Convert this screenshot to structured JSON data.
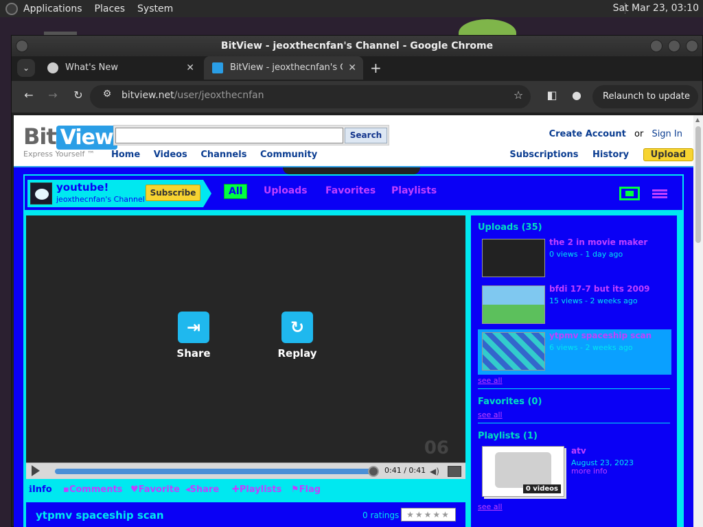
{
  "panel": {
    "applications": "Applications",
    "places": "Places",
    "system": "System",
    "clock": "Sat Mar 23, 03:10"
  },
  "window": {
    "title": "BitView - jeoxthecnfan's Channel - Google Chrome"
  },
  "tabs": [
    {
      "label": "What's New",
      "close": "✕"
    },
    {
      "label": "BitView - jeoxthecnfan's Cha",
      "close": "✕"
    }
  ],
  "toolbar": {
    "url_host": "bitview.net",
    "url_path": "/user/jeoxthecnfan",
    "relaunch": "Relaunch to update"
  },
  "site": {
    "logo_bit": "Bit",
    "logo_view": "View",
    "tagline": "Express Yourself ™",
    "search_button": "Search",
    "search_value": "",
    "nav": [
      "Home",
      "Videos",
      "Channels",
      "Community"
    ],
    "create_account": "Create Account",
    "or": "or",
    "sign_in": "Sign In",
    "subnav": [
      "Subscriptions",
      "History"
    ],
    "upload": "Upload"
  },
  "channel": {
    "name": "youtube!",
    "subtitle": "jeoxthecnfan's Channel",
    "subscribe": "Subscribe",
    "tabs": [
      "All",
      "Uploads",
      "Favorites",
      "Playlists"
    ]
  },
  "player": {
    "share": "Share",
    "replay": "Replay",
    "watermark": "06",
    "time": "0:41 / 0:41",
    "progress_fraction": 1.0
  },
  "info_tabs": [
    "Info",
    "Comments",
    "Favorite",
    "Share",
    "Playlists",
    "Flag"
  ],
  "video": {
    "title": "ytpmv spaceship scan",
    "ratings": "0 ratings"
  },
  "sidebar": {
    "uploads_heading": "Uploads (35)",
    "uploads": [
      {
        "title": "the 2 in movie maker",
        "meta": "0 views - 1 day ago"
      },
      {
        "title": "bfdi 17-7 but its 2009",
        "meta": "15 views - 2 weeks ago"
      },
      {
        "title": "ytpmv spaceship scan",
        "meta": "6 views - 2 weeks ago"
      }
    ],
    "see_all": "see all",
    "favorites_heading": "Favorites (0)",
    "playlists_heading": "Playlists (1)",
    "playlist": {
      "title": "atv",
      "date": "August 23, 2023",
      "more": "more info",
      "count": "0 videos"
    }
  },
  "colors": {
    "channel_bg": "#0a00f5",
    "channel_frame": "#00e8f0",
    "link_purple": "#c040ff",
    "accent_green": "#00ff40",
    "highlight": "#0aa0ff"
  }
}
